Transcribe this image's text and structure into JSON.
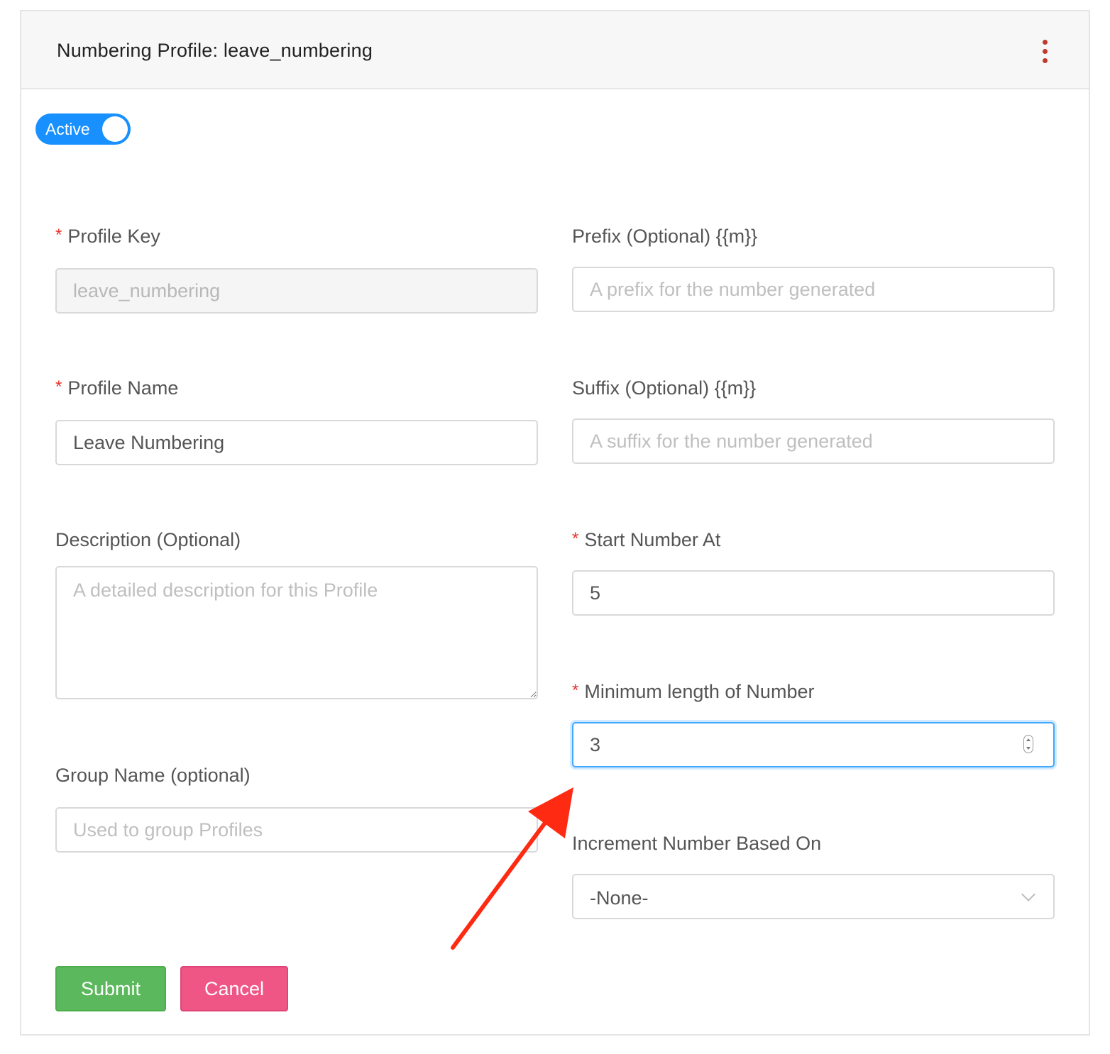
{
  "header": {
    "title": "Numbering Profile: leave_numbering"
  },
  "status_toggle": {
    "label": "Active",
    "on": true
  },
  "form": {
    "profile_key": {
      "required_mark": "*",
      "label": "Profile Key",
      "value": "leave_numbering"
    },
    "prefix": {
      "label": "Prefix (Optional) {{m}}",
      "placeholder": "A prefix for the number generated"
    },
    "profile_name": {
      "required_mark": "*",
      "label": "Profile Name",
      "value": "Leave Numbering"
    },
    "suffix": {
      "label": "Suffix (Optional) {{m}}",
      "placeholder": "A suffix for the number generated"
    },
    "description": {
      "label": "Description (Optional)",
      "placeholder": "A detailed description for this Profile"
    },
    "start_number": {
      "required_mark": "*",
      "label": "Start Number At",
      "value": "5"
    },
    "min_length": {
      "required_mark": "*",
      "label": "Minimum length of Number",
      "value": "3"
    },
    "group_name": {
      "label": "Group Name (optional)",
      "placeholder": "Used to group Profiles"
    },
    "increment": {
      "label": "Increment Number Based On",
      "selected": "-None-"
    }
  },
  "buttons": {
    "submit": "Submit",
    "cancel": "Cancel"
  },
  "colors": {
    "toggle_on": "#1890ff",
    "submit": "#5cb85c",
    "cancel": "#ef5585",
    "required": "#e8332b",
    "annotation_arrow": "#ff2a12",
    "menu_dots": "#c0392b"
  },
  "icons": {
    "menu": "kebab-menu-icon",
    "select": "chevron-down-icon",
    "stepper": "number-stepper-icon"
  }
}
